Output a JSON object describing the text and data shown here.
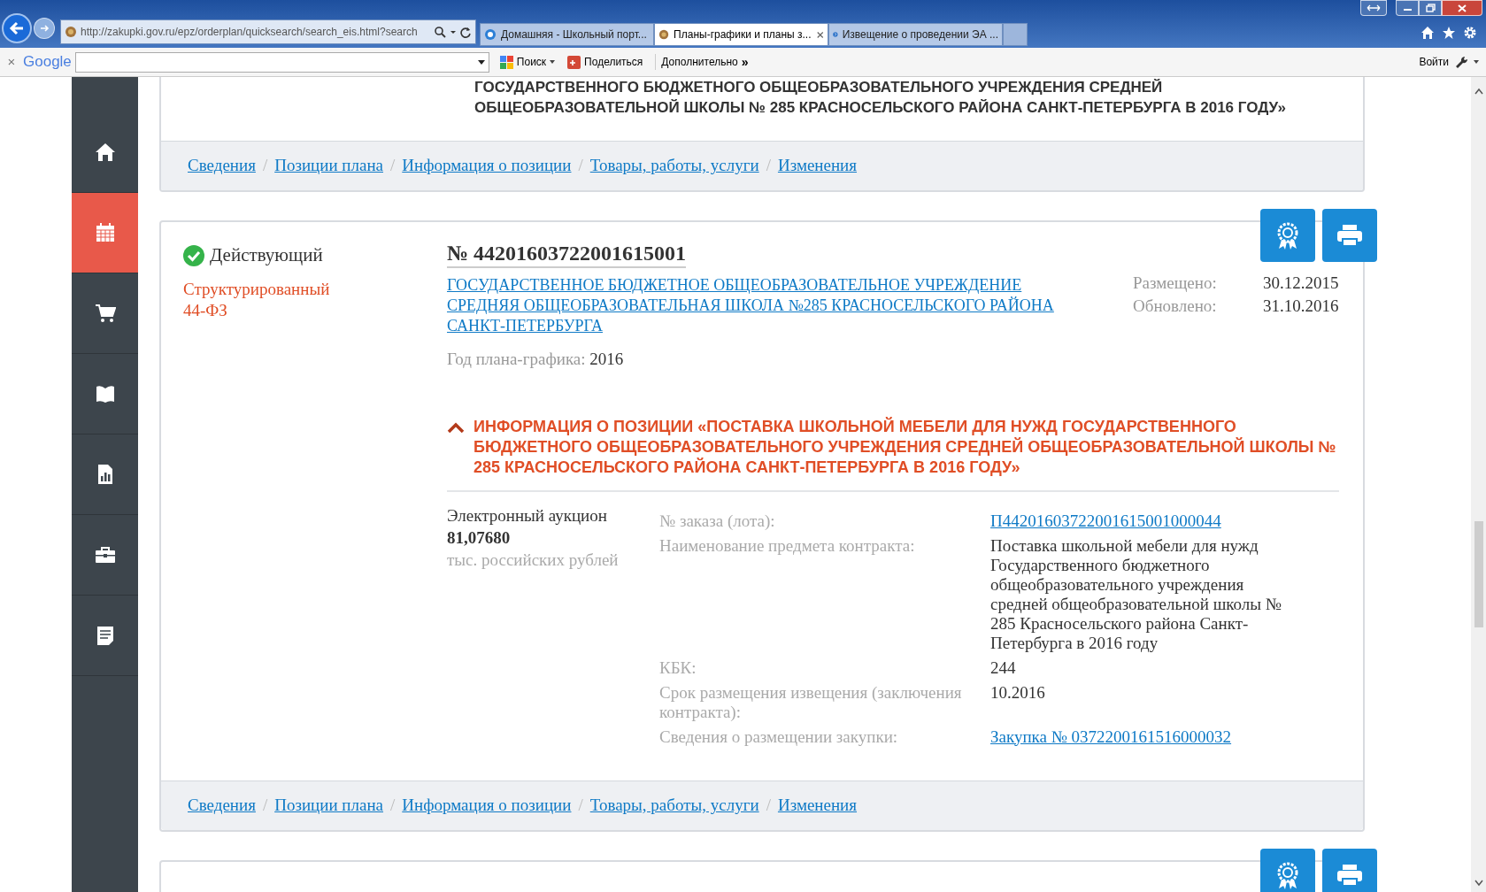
{
  "browser": {
    "address": "http://zakupki.gov.ru/epz/orderplan/quicksearch/search_eis.html?search",
    "tabs": [
      {
        "title": "Домашняя - Школьный порт...",
        "selected": false
      },
      {
        "title": "Планы-графики и планы з...",
        "selected": true
      },
      {
        "title": "Извещение о проведении ЭА ...",
        "selected": false
      }
    ],
    "toolbar": {
      "close": "×",
      "logo": "Google",
      "search_button": "Поиск",
      "share_button": "Поделиться",
      "more_button": "Дополнительно",
      "more_arrows": "»",
      "login": "Войти"
    }
  },
  "sidebar": [
    {
      "selected": false
    },
    {
      "selected": true
    },
    {
      "selected": false
    },
    {
      "selected": false
    },
    {
      "selected": false
    },
    {
      "selected": false
    },
    {
      "selected": false
    }
  ],
  "top_card": {
    "heading_lines": [
      "ГОСУДАРСТВЕННОГО БЮДЖЕТНОГО ОБЩЕОБРАЗОВАТЕЛЬНОГО УЧРЕЖДЕНИЯ СРЕДНЕЙ",
      "ОБЩЕОБРАЗОВАТЕЛЬНОЙ ШКОЛЫ № 285 КРАСНОСЕЛЬСКОГО РАЙОНА САНКТ-ПЕТЕРБУРГА В 2016 ГОДУ»"
    ],
    "nav": [
      {
        "label": "Сведения"
      },
      {
        "separator": "/",
        "label": "Позиции плана"
      },
      {
        "separator": "/",
        "label": "Информация о позиции"
      },
      {
        "separator": "/",
        "label": "Товары, работы, услуги"
      },
      {
        "separator": "/",
        "label": "Изменения"
      }
    ]
  },
  "plan_card": {
    "status": "Действующий",
    "type_lines": [
      "Структурированный",
      "44-ФЗ"
    ],
    "number": "№ 44201603722001615001",
    "customer": "ГОСУДАРСТВЕННОЕ БЮДЖЕТНОЕ ОБЩЕОБРАЗОВАТЕЛЬНОЕ УЧРЕЖДЕНИЕ СРЕДНЯЯ ОБЩЕОБРАЗОВАТЕЛЬНАЯ ШКОЛА №285 КРАСНОСЕЛЬСКОГО РАЙОНА САНКТ-ПЕТЕРБУРГА",
    "dates": [
      {
        "label": "Размещено:",
        "value": "30.12.2015"
      },
      {
        "label": "Обновлено:",
        "value": "31.10.2016"
      }
    ],
    "year_label": "Год плана-графика:",
    "year": "2016",
    "position": {
      "expanded": true,
      "title": "ИНФОРМАЦИЯ О ПОЗИЦИИ «ПОСТАВКА ШКОЛЬНОЙ МЕБЕЛИ ДЛЯ НУЖД ГОСУДАРСТВЕННОГО БЮДЖЕТНОГО ОБЩЕОБРАЗОВАТЕЛЬНОГО УЧРЕЖДЕНИЯ СРЕДНЕЙ ОБЩЕОБРАЗОВАТЕЛЬНОЙ ШКОЛЫ № 285 КРАСНОСЕЛЬСКОГО РАЙОНА САНКТ-ПЕТЕРБУРГА В 2016 ГОДУ»",
      "method": "Электронный аукцион",
      "amount": "81,07680",
      "currency": "тыс. российских рублей",
      "fields": [
        {
          "label": "№ заказа (лота):",
          "value": "П44201603722001615001000044",
          "kind": "link"
        },
        {
          "label": "Наименование предмета контракта:",
          "value": "Поставка школьной мебели для нужд Государственного бюджетного общеобразовательного учреждения средней общеобразовательной школы № 285 Красносельского района Санкт-Петербурга в 2016 году",
          "kind": "text"
        },
        {
          "label": "КБК:",
          "value": "244",
          "kind": "text"
        },
        {
          "label": "Срок размещения извещения (заключения контракта):",
          "value": "10.2016",
          "kind": "text"
        },
        {
          "label": "Сведения о размещении закупки:",
          "value": "Закупка № 0372200161516000032",
          "kind": "link"
        }
      ]
    },
    "nav": [
      {
        "label": "Сведения"
      },
      {
        "separator": "/",
        "label": "Позиции плана"
      },
      {
        "separator": "/",
        "label": "Информация о позиции"
      },
      {
        "separator": "/",
        "label": "Товары, работы, услуги"
      },
      {
        "separator": "/",
        "label": "Изменения"
      }
    ]
  }
}
